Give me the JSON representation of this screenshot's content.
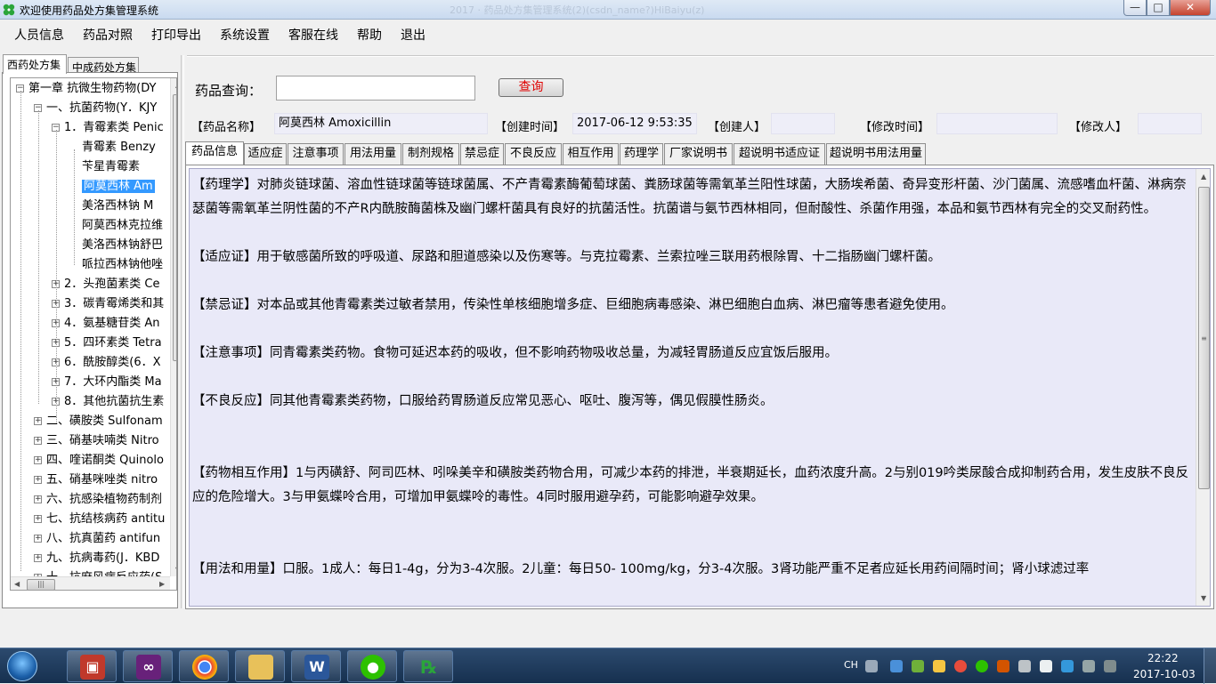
{
  "window": {
    "title": "欢迎使用药品处方集管理系统",
    "ghost_title": "2017 · 药品处方集管理系统(2)(csdn_name?)HiBaiyu(z)",
    "controls": {
      "minimize": "—",
      "maximize": "□",
      "close": "✕"
    }
  },
  "menu": [
    "人员信息",
    "药品对照",
    "打印导出",
    "系统设置",
    "客服在线",
    "帮助",
    "退出"
  ],
  "left_tabs": [
    "西药处方集",
    "中成药处方集"
  ],
  "tree": [
    {
      "label": "第一章  抗微生物药物(DY",
      "level": 0,
      "expander": "−"
    },
    {
      "label": "一、抗菌药物(Y．KJY",
      "level": 1,
      "expander": "−"
    },
    {
      "label": "1．青霉素类 Penic",
      "level": 2,
      "expander": "−"
    },
    {
      "label": "青霉素    Benzy",
      "level": 3,
      "expander": ""
    },
    {
      "label": "苄星青霉素     ",
      "level": 3,
      "expander": ""
    },
    {
      "label": "阿莫西林    Am",
      "level": 3,
      "expander": "",
      "selected": true
    },
    {
      "label": "美洛西林钠    M",
      "level": 3,
      "expander": ""
    },
    {
      "label": "阿莫西林克拉维",
      "level": 3,
      "expander": ""
    },
    {
      "label": "美洛西林钠舒巴",
      "level": 3,
      "expander": ""
    },
    {
      "label": "哌拉西林钠他唑",
      "level": 3,
      "expander": ""
    },
    {
      "label": "2．头孢菌素类 Ce",
      "level": 2,
      "expander": "+"
    },
    {
      "label": "3．碳青霉烯类和其",
      "level": 2,
      "expander": "+"
    },
    {
      "label": "4．氨基糖苷类 An",
      "level": 2,
      "expander": "+"
    },
    {
      "label": "5．四环素类 Tetra",
      "level": 2,
      "expander": "+"
    },
    {
      "label": "6．酰胺醇类(6．X",
      "level": 2,
      "expander": "+"
    },
    {
      "label": "7．大环内酯类 Ma",
      "level": 2,
      "expander": "+"
    },
    {
      "label": "8．其他抗菌抗生素",
      "level": 2,
      "expander": "+"
    },
    {
      "label": "二、磺胺类 Sulfonam",
      "level": 1,
      "expander": "+"
    },
    {
      "label": "三、硝基呋喃类 Nitro",
      "level": 1,
      "expander": "+"
    },
    {
      "label": "四、喹诺酮类 Quinolo",
      "level": 1,
      "expander": "+"
    },
    {
      "label": "五、硝基咪唑类 nitro",
      "level": 1,
      "expander": "+"
    },
    {
      "label": "六、抗感染植物药制剂",
      "level": 1,
      "expander": "+"
    },
    {
      "label": "七、抗结核病药 antitu",
      "level": 1,
      "expander": "+"
    },
    {
      "label": "八、抗真菌药 antifun",
      "level": 1,
      "expander": "+"
    },
    {
      "label": "九、抗病毒药(J．KBD",
      "level": 1,
      "expander": "+"
    },
    {
      "label": "十、抗麻风病反应药(S",
      "level": 1,
      "expander": "+"
    }
  ],
  "query": {
    "label": "药品查询：",
    "value": "",
    "button": "查询"
  },
  "info": {
    "name_label": "【药品名称】",
    "name_value": "阿莫西林    Amoxicillin",
    "created_time_label": "【创建时间】",
    "created_time_value": "2017-06-12 9:53:35",
    "creator_label": "【创建人】",
    "creator_value": "",
    "modified_time_label": "【修改时间】",
    "modified_time_value": "",
    "modifier_label": "【修改人】",
    "modifier_value": ""
  },
  "tabs": [
    "药品信息",
    "适应症",
    "注意事项",
    "用法用量",
    "制剂规格",
    "禁忌症",
    "不良反应",
    "相互作用",
    "药理学",
    "厂家说明书",
    "超说明书适应证",
    "超说明书用法用量"
  ],
  "active_tab": 0,
  "content": {
    "pharmacology": "【药理学】对肺炎链球菌、溶血性链球菌等链球菌属、不产青霉素酶葡萄球菌、粪肠球菌等需氧革兰阳性球菌，大肠埃希菌、奇异变形杆菌、沙门菌属、流感嗜血杆菌、淋病奈瑟菌等需氧革兰阴性菌的不产R内酰胺酶菌株及幽门螺杆菌具有良好的抗菌活性。抗菌谱与氨节西林相同，但耐酸性、杀菌作用强，本品和氨节西林有完全的交叉耐药性。",
    "indications": "【适应证】用于敏感菌所致的呼吸道、尿路和胆道感染以及伤寒等。与克拉霉素、兰索拉唑三联用药根除胃、十二指肠幽门螺杆菌。",
    "contraindications": "【禁忌证】对本品或其他青霉素类过敏者禁用，传染性单核细胞增多症、巨细胞病毒感染、淋巴细胞白血病、淋巴瘤等患者避免使用。",
    "precautions": "【注意事项】同青霉素类药物。食物可延迟本药的吸收，但不影响药物吸收总量，为减轻胃肠道反应宜饭后服用。",
    "adverse": "【不良反应】同其他青霉素类药物，口服给药胃肠道反应常见恶心、呕吐、腹泻等，偶见假膜性肠炎。",
    "interactions": "【药物相互作用】1与丙磺舒、阿司匹林、吲哚美辛和磺胺类药物合用，可减少本药的排泄，半衰期延长，血药浓度升高。2与别019吟类尿酸合成抑制药合用，发生皮肤不良反应的危险增大。3与甲氨蝶呤合用，可增加甲氨蝶呤的毒性。4同时服用避孕药，可能影响避孕效果。",
    "dosage": "【用法和用量】口服。1成人：每日1-4g，分为3-4次服。2儿童：每日50- 100mg/kg，分3-4次服。3肾功能严重不足者应延长用药间隔时间；肾小球滤过率"
  },
  "taskbar": {
    "lang": "CH",
    "time": "22:22",
    "date": "2017-10-03",
    "apps": [
      "toolbox",
      "visual-studio",
      "chrome",
      "file-explorer",
      "word",
      "wechat",
      "rx-app"
    ]
  },
  "colors": {
    "content_bg": "#e9e9f8",
    "selection": "#3399ff",
    "query_button_text": "#e00000"
  }
}
